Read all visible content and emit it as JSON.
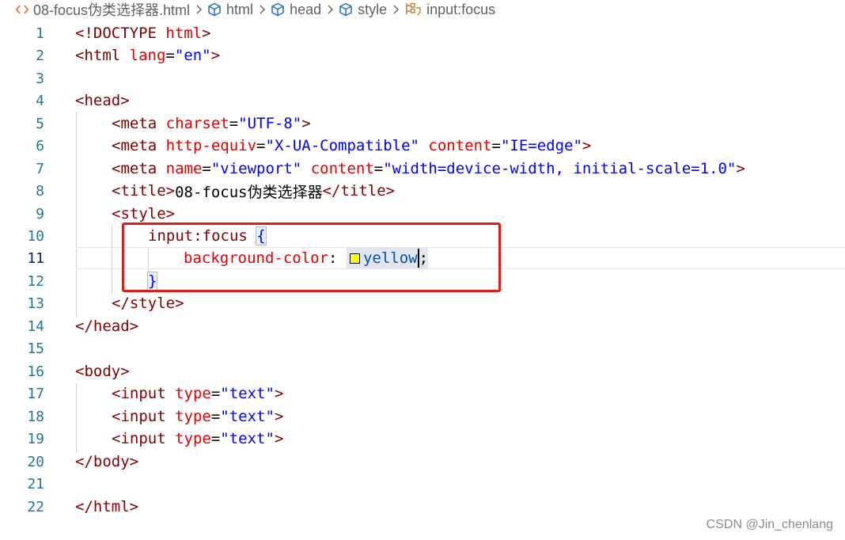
{
  "breadcrumb": {
    "items": [
      {
        "label": "08-focus伪类选择器.html",
        "icon": "html-file-icon"
      },
      {
        "label": "html",
        "icon": "cube-icon"
      },
      {
        "label": "head",
        "icon": "cube-icon"
      },
      {
        "label": "style",
        "icon": "cube-icon"
      },
      {
        "label": "input:focus",
        "icon": "css-selector-icon"
      }
    ]
  },
  "editor": {
    "line_numbers": [
      "1",
      "2",
      "3",
      "4",
      "5",
      "6",
      "7",
      "8",
      "9",
      "10",
      "11",
      "12",
      "13",
      "14",
      "15",
      "16",
      "17",
      "18",
      "19",
      "20",
      "21",
      "22"
    ],
    "current_line": 11,
    "colors": {
      "tag": "#800000",
      "attribute": "#e50000",
      "string": "#0000ff",
      "css_value": "#0451a5",
      "highlight_box": "#e01b1b",
      "swatch_yellow": "#ffff00"
    },
    "lines": {
      "l1": {
        "a": "<!DOCTYPE",
        "b": " html",
        "c": ">"
      },
      "l2": {
        "tag": "<html",
        "attr": " lang",
        "eq": "=",
        "val": "\"en\"",
        "end": ">"
      },
      "l4": {
        "tag": "<head>"
      },
      "l5": {
        "tag": "<meta",
        "attr": " charset",
        "eq": "=",
        "val": "\"UTF-8\"",
        "end": ">"
      },
      "l6": {
        "tag": "<meta",
        "attr1": " http-equiv",
        "eq1": "=",
        "val1": "\"X-UA-Compatible\"",
        "attr2": " content",
        "eq2": "=",
        "val2": "\"IE=edge\"",
        "end": ">"
      },
      "l7": {
        "tag": "<meta",
        "attr1": " name",
        "eq1": "=",
        "val1": "\"viewport\"",
        "attr2": " content",
        "eq2": "=",
        "val2": "\"width=device-width, initial-scale=1.0\"",
        "end": ">"
      },
      "l8": {
        "open": "<title>",
        "text": "08-focus伪类选择器",
        "close": "</title>"
      },
      "l9": {
        "tag": "<style>"
      },
      "l10": {
        "selector": "input:focus",
        "brace": "{"
      },
      "l11": {
        "prop": "background-color",
        "colon": ":",
        "value": "yellow",
        "semi": ";"
      },
      "l12": {
        "brace": "}"
      },
      "l13": {
        "tag": "</style>"
      },
      "l14": {
        "tag": "</head>"
      },
      "l16": {
        "tag": "<body>"
      },
      "l17": {
        "tag": "<input",
        "attr": " type",
        "eq": "=",
        "val": "\"text\"",
        "end": ">"
      },
      "l18": {
        "tag": "<input",
        "attr": " type",
        "eq": "=",
        "val": "\"text\"",
        "end": ">"
      },
      "l19": {
        "tag": "<input",
        "attr": " type",
        "eq": "=",
        "val": "\"text\"",
        "end": ">"
      },
      "l20": {
        "tag": "</body>"
      },
      "l22": {
        "tag": "</html>"
      }
    }
  },
  "watermark": "CSDN @Jin_chenlang"
}
